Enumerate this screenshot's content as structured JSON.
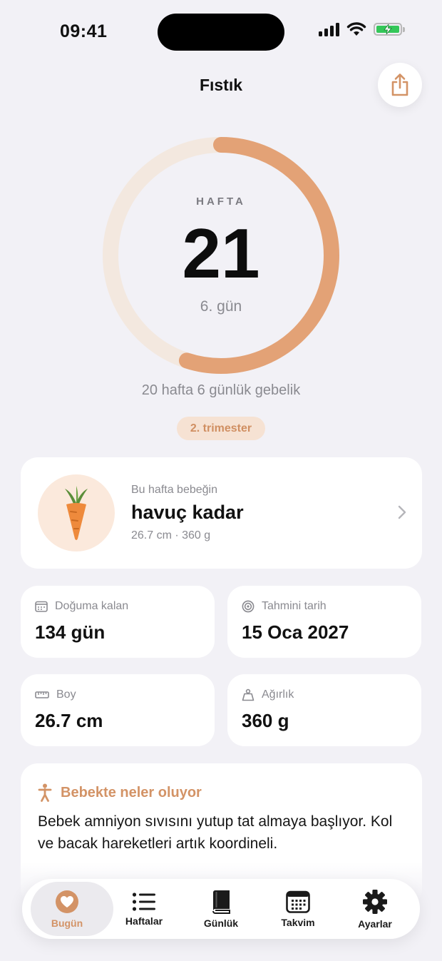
{
  "status_bar": {
    "time": "09:41"
  },
  "header": {
    "title": "Fıstık"
  },
  "progress": {
    "label": "HAFTA",
    "week": "21",
    "day": "6. gün",
    "fraction": 0.55,
    "gestation": "20 hafta 6 günlük gebelik",
    "trimester": "2. trimester"
  },
  "baby_card": {
    "subtitle": "Bu hafta bebeğin",
    "size_text": "havuç kadar",
    "metrics": "26.7 cm · 360 g",
    "icon": "carrot-icon"
  },
  "stats": [
    {
      "label": "Doğuma kalan",
      "value": "134 gün",
      "icon": "calendar-icon"
    },
    {
      "label": "Tahmini tarih",
      "value": "15 Oca 2027",
      "icon": "target-icon"
    },
    {
      "label": "Boy",
      "value": "26.7 cm",
      "icon": "ruler-icon"
    },
    {
      "label": "Ağırlık",
      "value": "360 g",
      "icon": "weight-icon"
    }
  ],
  "info": {
    "title": "Bebekte neler oluyor",
    "body": "Bebek amniyon sıvısını yutup tat almaya başlıyor. Kol ve bacak hareketleri artık koordineli.",
    "icon": "figure-icon"
  },
  "tabs": [
    {
      "label": "Bugün",
      "icon": "heart-icon",
      "active": true
    },
    {
      "label": "Haftalar",
      "icon": "list-icon",
      "active": false
    },
    {
      "label": "Günlük",
      "icon": "book-icon",
      "active": false
    },
    {
      "label": "Takvim",
      "icon": "calendar-grid-icon",
      "active": false
    },
    {
      "label": "Ayarlar",
      "icon": "gear-icon",
      "active": false
    }
  ],
  "colors": {
    "accent": "#D39366",
    "ring_track": "#F3E8DF",
    "ring_progress": "#E3A276",
    "background": "#F2F1F6"
  }
}
